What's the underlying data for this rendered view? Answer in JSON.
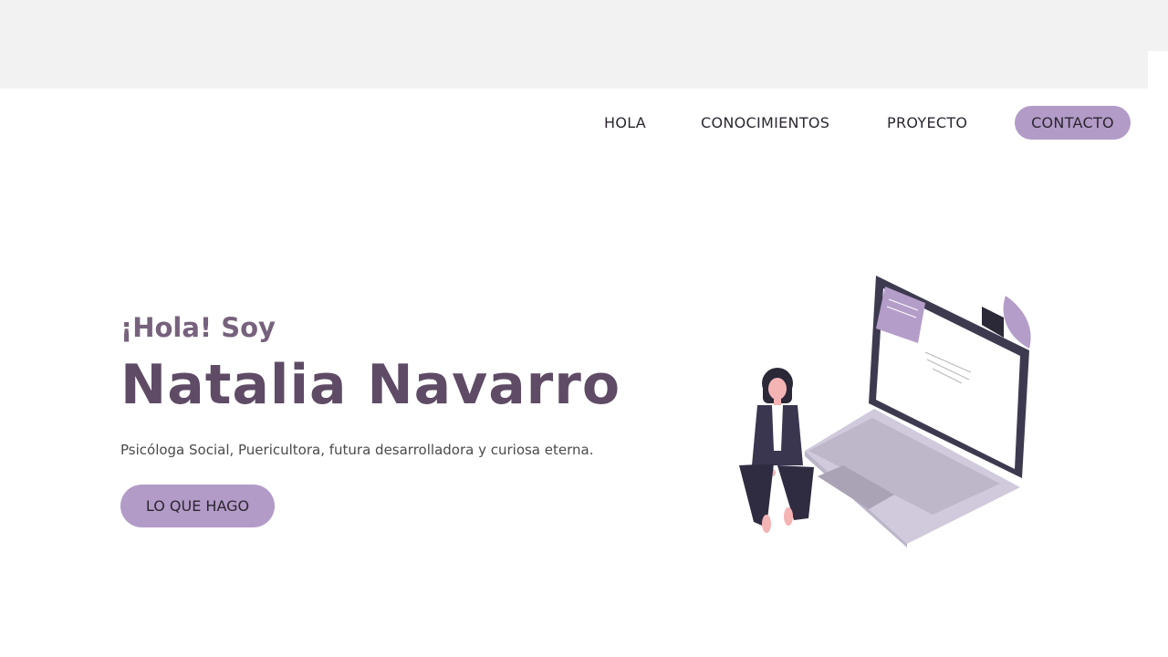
{
  "nav": {
    "items": [
      {
        "label": "HOLA"
      },
      {
        "label": "CONOCIMIENTOS"
      },
      {
        "label": "PROYECTO"
      }
    ],
    "cta_label": "CONTACTO"
  },
  "hero": {
    "greeting": "¡Hola! Soy",
    "name": "Natalia Navarro",
    "subtitle": "Psicóloga Social, Puericultora, futura desarrolladora y curiosa eterna.",
    "button_label": "LO QUE HAGO"
  },
  "illustration_icon": "woman-sitting-with-laptop-illustration",
  "colors": {
    "accent": "#b39bc8",
    "heading": "#5f4b66",
    "greeting": "#77627d",
    "top_band": "#f2f2f2",
    "text": "#2b2630"
  }
}
